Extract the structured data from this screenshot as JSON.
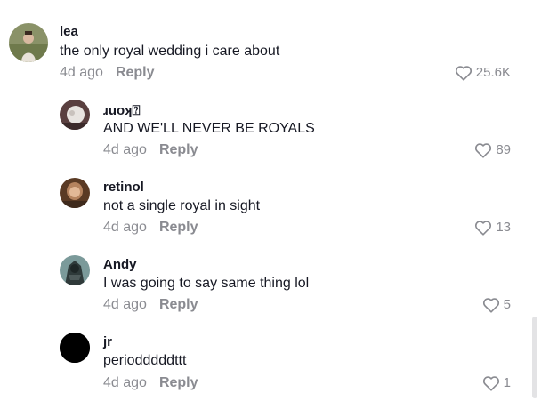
{
  "comments": [
    {
      "username": "lea",
      "text": "the only royal wedding i care about",
      "time": "4d ago",
      "reply_label": "Reply",
      "likes": "25.6K",
      "avatar_color": "#7f8c5a"
    },
    {
      "username": "ɹuoʞ⍰",
      "text": "AND WE'LL NEVER BE ROYALS",
      "time": "4d ago",
      "reply_label": "Reply",
      "likes": "89",
      "avatar_color": "#6f5a5a"
    },
    {
      "username": "retinol",
      "text": "not a single royal in sight",
      "time": "4d ago",
      "reply_label": "Reply",
      "likes": "13",
      "avatar_color": "#8a5a3c"
    },
    {
      "username": "Andy",
      "text": "I was going to say same thing lol",
      "time": "4d ago",
      "reply_label": "Reply",
      "likes": "5",
      "avatar_color": "#4f6a6a"
    },
    {
      "username": "jr",
      "text": "periodddddttt",
      "time": "4d ago",
      "reply_label": "Reply",
      "likes": "1",
      "avatar_color": "#000000"
    }
  ],
  "icons": {
    "like": "heart-outline-icon"
  },
  "colors": {
    "text_primary": "#161823",
    "text_secondary": "#8a8b91",
    "background": "#ffffff"
  }
}
